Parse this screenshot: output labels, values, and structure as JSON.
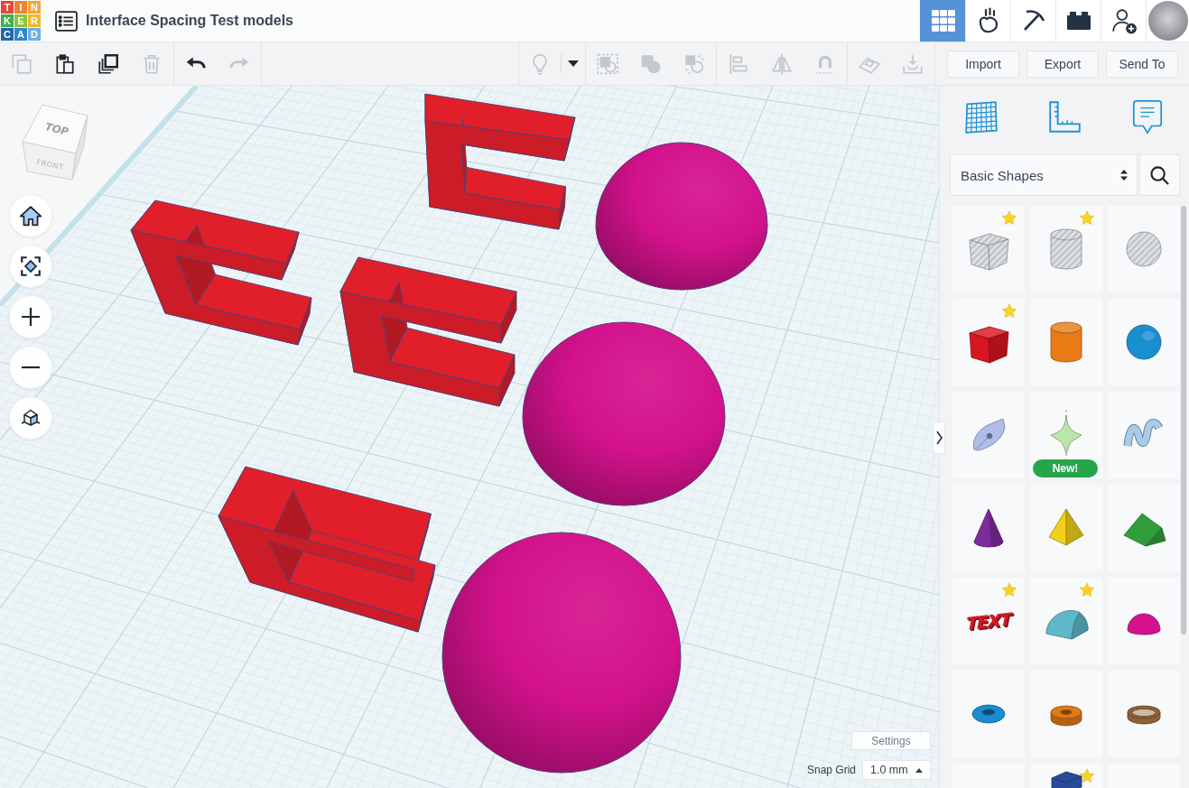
{
  "topbar": {
    "logo": [
      {
        "letter": "T",
        "color": "#e8463b"
      },
      {
        "letter": "I",
        "color": "#ef8331"
      },
      {
        "letter": "N",
        "color": "#f5a33c"
      },
      {
        "letter": "K",
        "color": "#3fb04b"
      },
      {
        "letter": "E",
        "color": "#8cc43f"
      },
      {
        "letter": "R",
        "color": "#f2b829"
      },
      {
        "letter": "C",
        "color": "#1f67b1"
      },
      {
        "letter": "A",
        "color": "#2f86c8"
      },
      {
        "letter": "D",
        "color": "#6bb2e0"
      }
    ],
    "title": "Interface Spacing Test models",
    "views": [
      {
        "kind": "grid",
        "selected": true
      },
      {
        "kind": "pebble",
        "selected": false
      },
      {
        "kind": "pickaxe",
        "selected": false
      },
      {
        "kind": "brick",
        "selected": false
      }
    ],
    "actions": [
      {
        "kind": "add-user"
      },
      {
        "kind": "avatar"
      }
    ]
  },
  "toolbar": {
    "left": [
      [
        {
          "kind": "copy",
          "disabled": true
        },
        {
          "kind": "paste",
          "disabled": false
        },
        {
          "kind": "duplicate",
          "disabled": false
        },
        {
          "kind": "delete",
          "disabled": true
        }
      ],
      [
        {
          "kind": "undo",
          "disabled": false
        },
        {
          "kind": "redo",
          "disabled": true
        }
      ]
    ],
    "right": [
      [
        {
          "kind": "lightbulb",
          "disabled": true
        },
        {
          "kind": "dropdown",
          "disabled": false
        }
      ],
      [
        {
          "kind": "group",
          "disabled": true
        },
        {
          "kind": "solid",
          "disabled": true
        },
        {
          "kind": "hole",
          "disabled": true
        }
      ],
      [
        {
          "kind": "align",
          "disabled": true
        },
        {
          "kind": "mirror",
          "disabled": true
        },
        {
          "kind": "magnet",
          "disabled": true
        }
      ],
      [
        {
          "kind": "workplane",
          "disabled": true
        },
        {
          "kind": "drop",
          "disabled": true
        }
      ]
    ],
    "buttons": [
      "Import",
      "Export",
      "Send To"
    ]
  },
  "viewport": {
    "view_cube": {
      "top": "TOP",
      "front": "FRONT"
    },
    "nav": [
      {
        "kind": "home"
      },
      {
        "kind": "fit"
      },
      {
        "kind": "zoom-in"
      },
      {
        "kind": "zoom-out"
      },
      {
        "kind": "perspective"
      }
    ],
    "objects": [
      {
        "kind": "bracket",
        "color": "#e01f2b"
      },
      {
        "kind": "dome",
        "color": "#d3128c"
      },
      {
        "kind": "bracket",
        "color": "#e01f2b"
      },
      {
        "kind": "bracket",
        "color": "#e01f2b"
      },
      {
        "kind": "dome",
        "color": "#d3128c"
      },
      {
        "kind": "bracket",
        "color": "#e01f2b"
      },
      {
        "kind": "dome",
        "color": "#d3128c"
      }
    ],
    "settings": "Settings",
    "snap_grid": {
      "label": "Snap Grid",
      "value": "1.0 mm"
    }
  },
  "panel": {
    "tools": [
      {
        "kind": "workplane"
      },
      {
        "kind": "ruler"
      },
      {
        "kind": "notes"
      }
    ],
    "category": "Basic Shapes",
    "shapes": [
      {
        "kind": "box",
        "hole": true,
        "favorite": true,
        "color": "#c3c7cd"
      },
      {
        "kind": "cylinder",
        "hole": true,
        "favorite": true,
        "color": "#c3c7cd"
      },
      {
        "kind": "sphere",
        "hole": true,
        "favorite": false,
        "color": "#c3c7cd"
      },
      {
        "kind": "box",
        "hole": false,
        "favorite": true,
        "color": "#d9151f"
      },
      {
        "kind": "cylinder",
        "hole": false,
        "favorite": false,
        "color": "#e87b16"
      },
      {
        "kind": "sphere",
        "hole": false,
        "favorite": false,
        "color": "#1a8fcf"
      },
      {
        "kind": "scribble",
        "hole": false,
        "favorite": false,
        "color": "#aebde9"
      },
      {
        "kind": "spinner",
        "hole": false,
        "favorite": false,
        "color": "#b9e6a9",
        "badge": "New!"
      },
      {
        "kind": "ribbon",
        "hole": false,
        "favorite": false,
        "color": "#a9cbe9"
      },
      {
        "kind": "cone",
        "hole": false,
        "favorite": false,
        "color": "#7d2a9a"
      },
      {
        "kind": "pyramid",
        "hole": false,
        "favorite": false,
        "color": "#f1d117"
      },
      {
        "kind": "roof",
        "hole": false,
        "favorite": false,
        "color": "#2f9e3a"
      },
      {
        "kind": "text",
        "hole": false,
        "favorite": true,
        "color": "#d21a27",
        "label": "TEXT"
      },
      {
        "kind": "round-roof",
        "hole": false,
        "favorite": true,
        "color": "#5db8c9"
      },
      {
        "kind": "half-sphere",
        "hole": false,
        "favorite": false,
        "color": "#d3128c"
      },
      {
        "kind": "torus",
        "hole": false,
        "favorite": false,
        "color": "#1c8bcf"
      },
      {
        "kind": "tube",
        "hole": false,
        "favorite": false,
        "color": "#e07a17"
      },
      {
        "kind": "ring",
        "hole": false,
        "favorite": false,
        "color": "#8e6136"
      },
      {
        "kind": "blank",
        "favorite": false
      },
      {
        "kind": "prism",
        "hole": false,
        "favorite": true,
        "color": "#2a4a9c"
      },
      {
        "kind": "blank",
        "favorite": false
      }
    ]
  }
}
